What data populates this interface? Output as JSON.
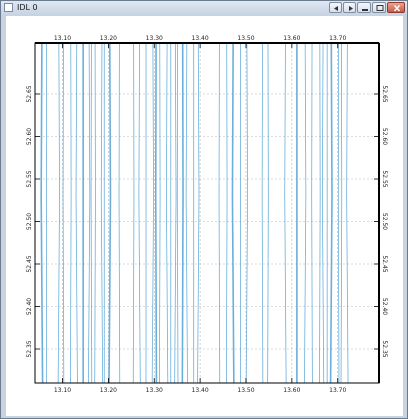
{
  "window": {
    "title": "IDL 0",
    "buttons": [
      {
        "name": "window-scroll-left-button",
        "icon": "arrow-left-icon"
      },
      {
        "name": "window-scroll-right-button",
        "icon": "arrow-right-icon"
      },
      {
        "name": "window-minimize-button",
        "icon": "minimize-icon"
      },
      {
        "name": "window-maximize-button",
        "icon": "maximize-icon"
      },
      {
        "name": "window-close-button",
        "icon": "close-icon"
      }
    ]
  },
  "plot": {
    "x_ticks": [
      "13.10",
      "13.20",
      "13.30",
      "13.40",
      "13.50",
      "13.60",
      "13.70"
    ],
    "y_ticks": [
      "52.35",
      "52.40",
      "52.45",
      "52.50",
      "52.55",
      "52.60",
      "52.65"
    ],
    "colors": {
      "line": "#5aa6d8",
      "grid": "#b8b8b8",
      "axis": "#000000"
    }
  },
  "chart_data": {
    "type": "line",
    "title": "",
    "xlabel": "",
    "ylabel": "",
    "xlim": [
      13.04,
      13.79
    ],
    "ylim": [
      52.31,
      52.71
    ],
    "grid": true,
    "x_tick_values": [
      13.1,
      13.2,
      13.3,
      13.4,
      13.5,
      13.6,
      13.7
    ],
    "y_tick_values": [
      52.35,
      52.4,
      52.45,
      52.5,
      52.55,
      52.6,
      52.65
    ],
    "series_x_positions": [
      13.055,
      13.065,
      13.092,
      13.102,
      13.118,
      13.131,
      13.145,
      13.158,
      13.163,
      13.171,
      13.186,
      13.191,
      13.203,
      13.224,
      13.255,
      13.268,
      13.282,
      13.297,
      13.304,
      13.312,
      13.328,
      13.336,
      13.346,
      13.351,
      13.362,
      13.371,
      13.386,
      13.396,
      13.442,
      13.458,
      13.472,
      13.488,
      13.502,
      13.536,
      13.548,
      13.586,
      13.611,
      13.629,
      13.644,
      13.661,
      13.668,
      13.677,
      13.686,
      13.702,
      13.708,
      13.721
    ]
  }
}
